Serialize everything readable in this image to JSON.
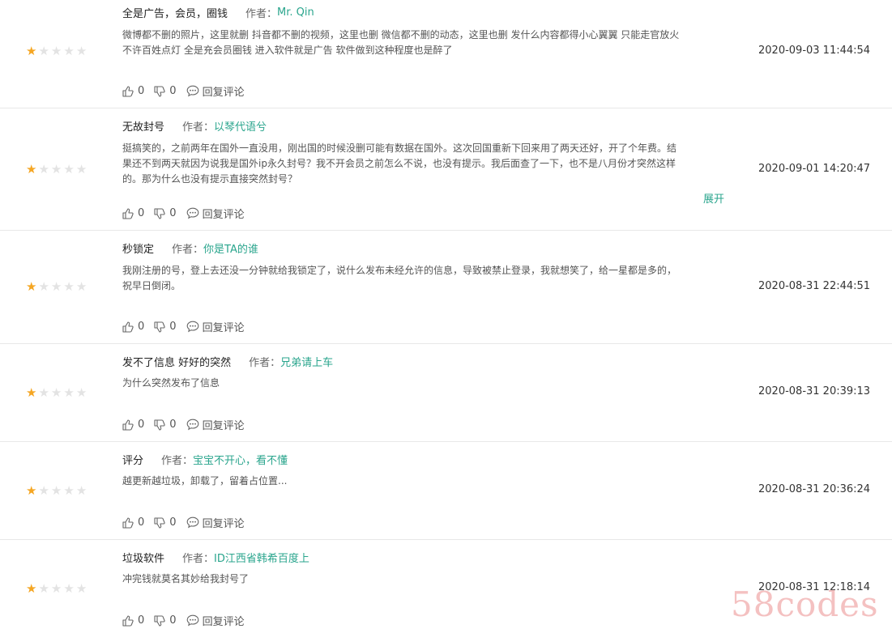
{
  "labels": {
    "author_prefix": "作者：",
    "reply": "回复评论",
    "expand": "展开"
  },
  "colors": {
    "star_on": "#f5a623",
    "star_off": "#e3e3e3",
    "author_link": "#2aa58d"
  },
  "reviews": [
    {
      "title": "全是广告，会员，圈钱",
      "author": "Mr. Qin",
      "rating": 1,
      "lines": [
        "微博都不删的照片，这里就删 抖音都不删的视频，这里也删 微信都不删的动态，这里也删 发什么内容都得小心翼翼 只能走官放火",
        "不许百姓点灯 全是充会员圈钱 进入软件就是广告 软件做到这种程度也是醉了"
      ],
      "date": "2020-09-03 11:44:54",
      "likes": "0",
      "dislikes": "0"
    },
    {
      "title": "无故封号",
      "author": "以琴代语兮",
      "rating": 1,
      "lines": [
        "挺搞笑的，之前两年在国外一直没用，刚出国的时候没删可能有数据在国外。这次回国重新下回来用了两天还好，开了个年费。结",
        "果还不到两天就因为说我是国外ip永久封号？我不开会员之前怎么不说，也没有提示。我后面查了一下，也不是八月份才突然这样",
        "的。那为什么也没有提示直接突然封号？"
      ],
      "date": "2020-09-01 14:20:47",
      "likes": "0",
      "dislikes": "0"
    },
    {
      "title": "秒锁定",
      "author": "你是TA的谁",
      "rating": 1,
      "lines": [
        "我刚注册的号，登上去还没一分钟就给我锁定了，说什么发布未经允许的信息，导致被禁止登录，我就想笑了，给一星都是多的，",
        "祝早日倒闭。"
      ],
      "date": "2020-08-31 22:44:51",
      "likes": "0",
      "dislikes": "0"
    },
    {
      "title": "发不了信息 好好的突然",
      "author": "兄弟请上车",
      "rating": 1,
      "lines": [
        "为什么突然发布了信息"
      ],
      "date": "2020-08-31 20:39:13",
      "likes": "0",
      "dislikes": "0"
    },
    {
      "title": "评分",
      "author": "宝宝不开心，看不懂",
      "rating": 1,
      "lines": [
        "越更新越垃圾，卸载了，留着占位置..."
      ],
      "date": "2020-08-31 20:36:24",
      "likes": "0",
      "dislikes": "0"
    },
    {
      "title": "垃圾软件",
      "author": "ID江西省韩希百度上",
      "rating": 1,
      "lines": [
        "冲完钱就莫名其妙给我封号了"
      ],
      "date": "2020-08-31 12:18:14",
      "likes": "0",
      "dislikes": "0"
    }
  ],
  "watermark": "58codes"
}
